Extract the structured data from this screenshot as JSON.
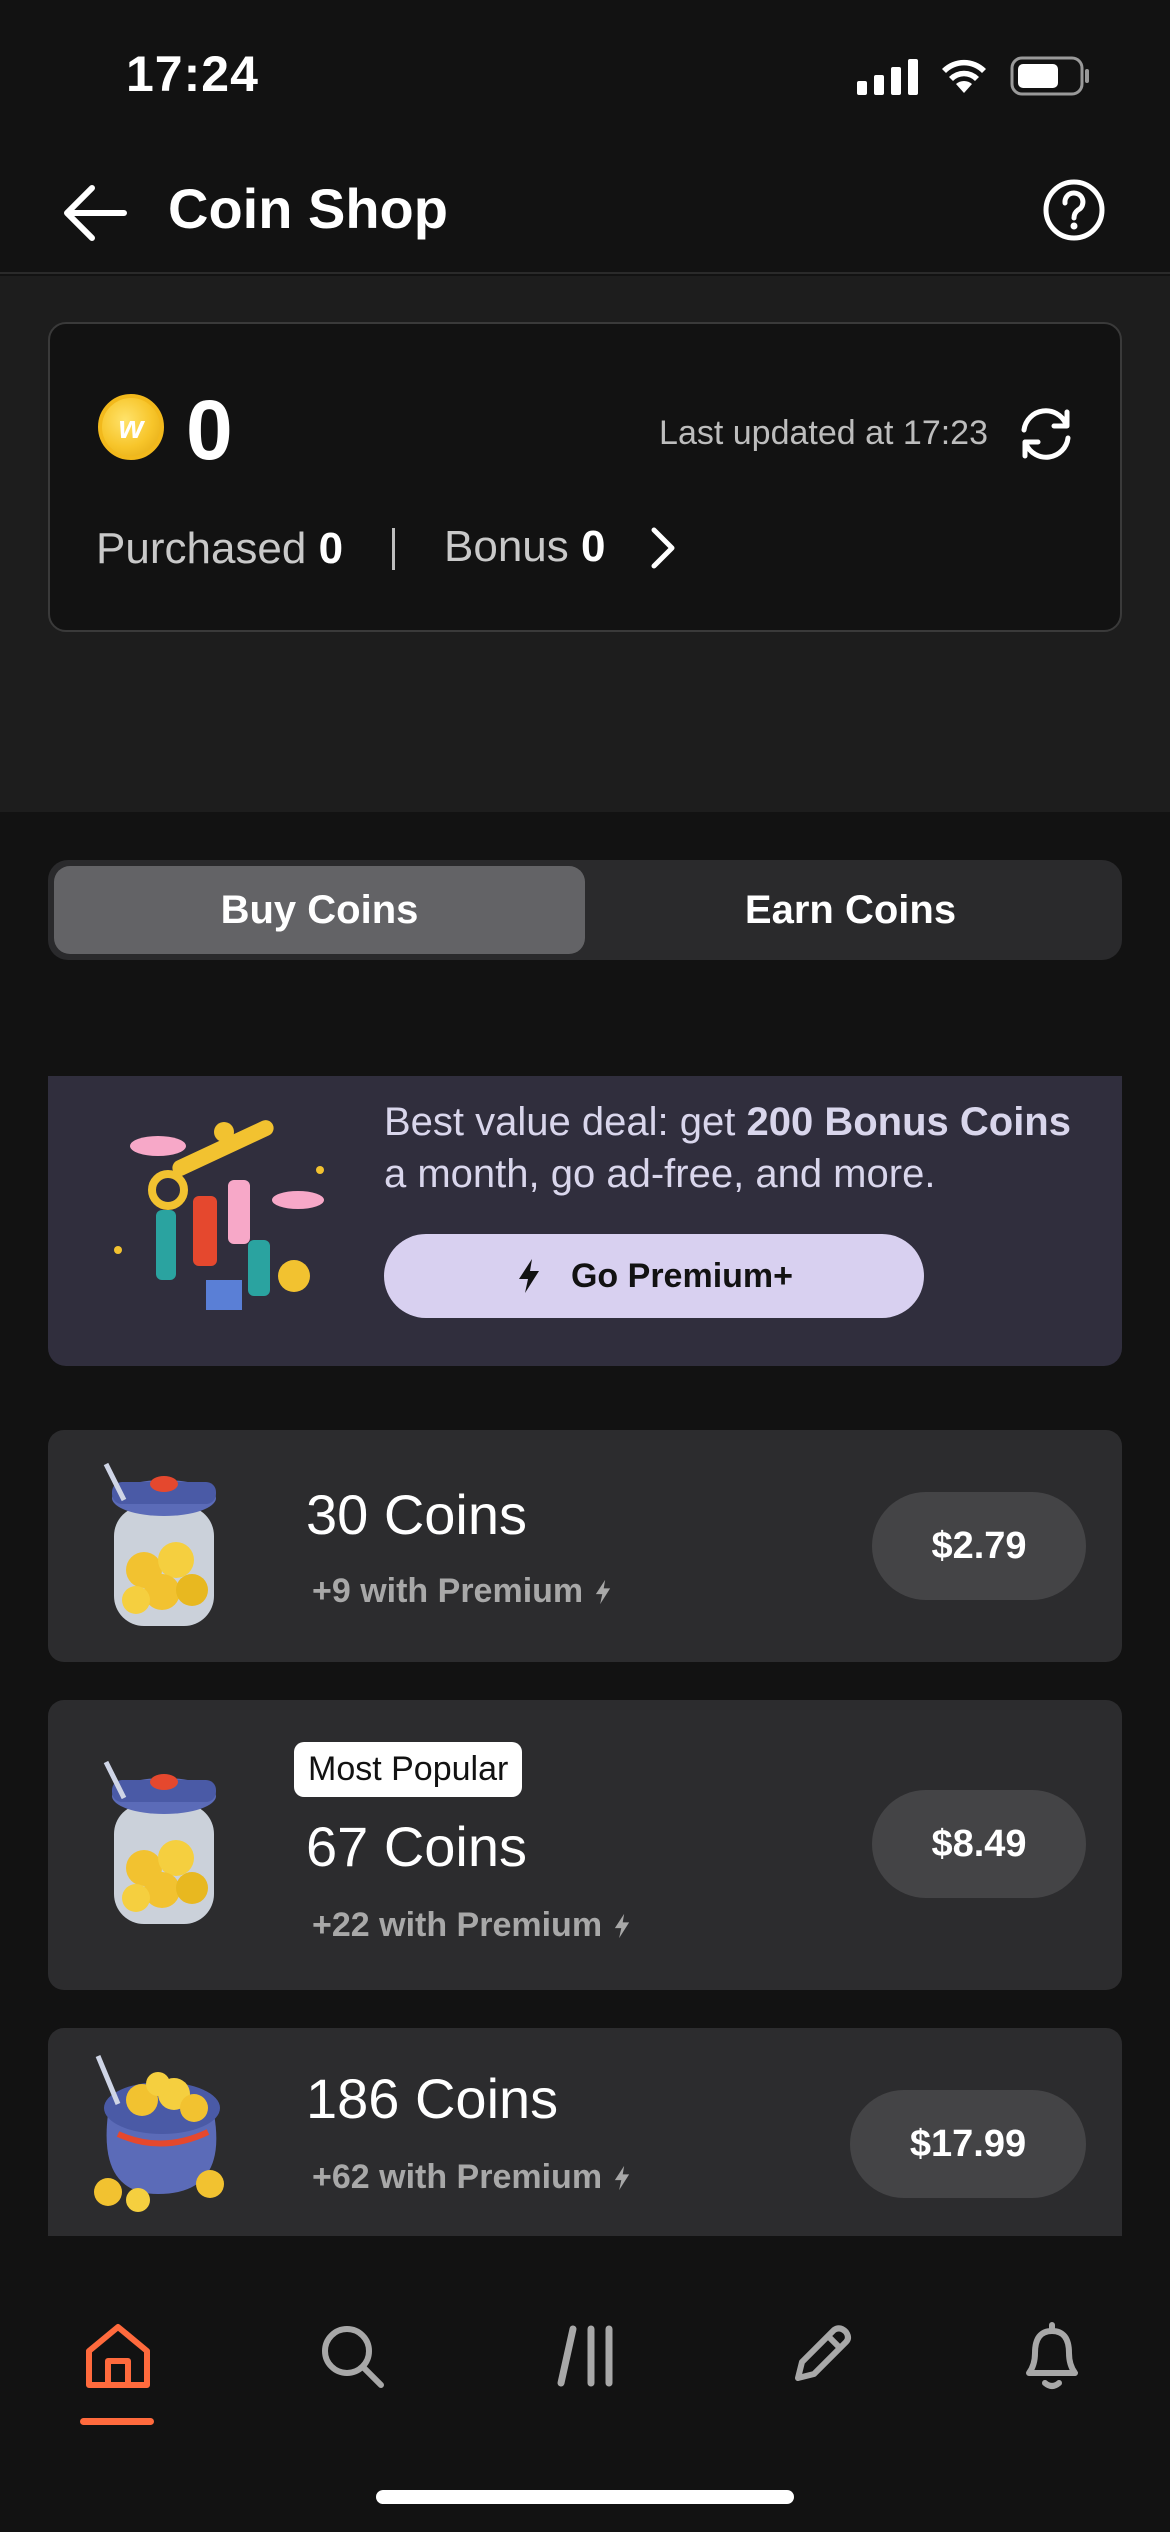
{
  "status_bar": {
    "time": "17:24"
  },
  "header": {
    "title": "Coin Shop"
  },
  "balance": {
    "value": "0",
    "last_updated": "Last updated at 17:23",
    "purchased_label": "Purchased",
    "purchased_value": "0",
    "bonus_label": "Bonus",
    "bonus_value": "0"
  },
  "tabs": {
    "buy": "Buy Coins",
    "earn": "Earn Coins",
    "active": "buy"
  },
  "premium": {
    "text_before": "Best value deal: get ",
    "text_bold": "200 Bonus Coins",
    "text_after": " a month, go ad-free, and more.",
    "button_label": "Go Premium+"
  },
  "packages": [
    {
      "name": "30 Coins",
      "bonus": "+9 with Premium",
      "price": "$2.79",
      "badge": ""
    },
    {
      "name": "67 Coins",
      "bonus": "+22 with Premium",
      "price": "$8.49",
      "badge": "Most Popular"
    },
    {
      "name": "186 Coins",
      "bonus": "+62 with Premium",
      "price": "$17.99",
      "badge": ""
    }
  ],
  "nav": {
    "items": [
      "home-icon",
      "search-icon",
      "library-icon",
      "write-icon",
      "notifications-icon"
    ],
    "active": "home-icon",
    "accent": "#ff6a3d"
  }
}
